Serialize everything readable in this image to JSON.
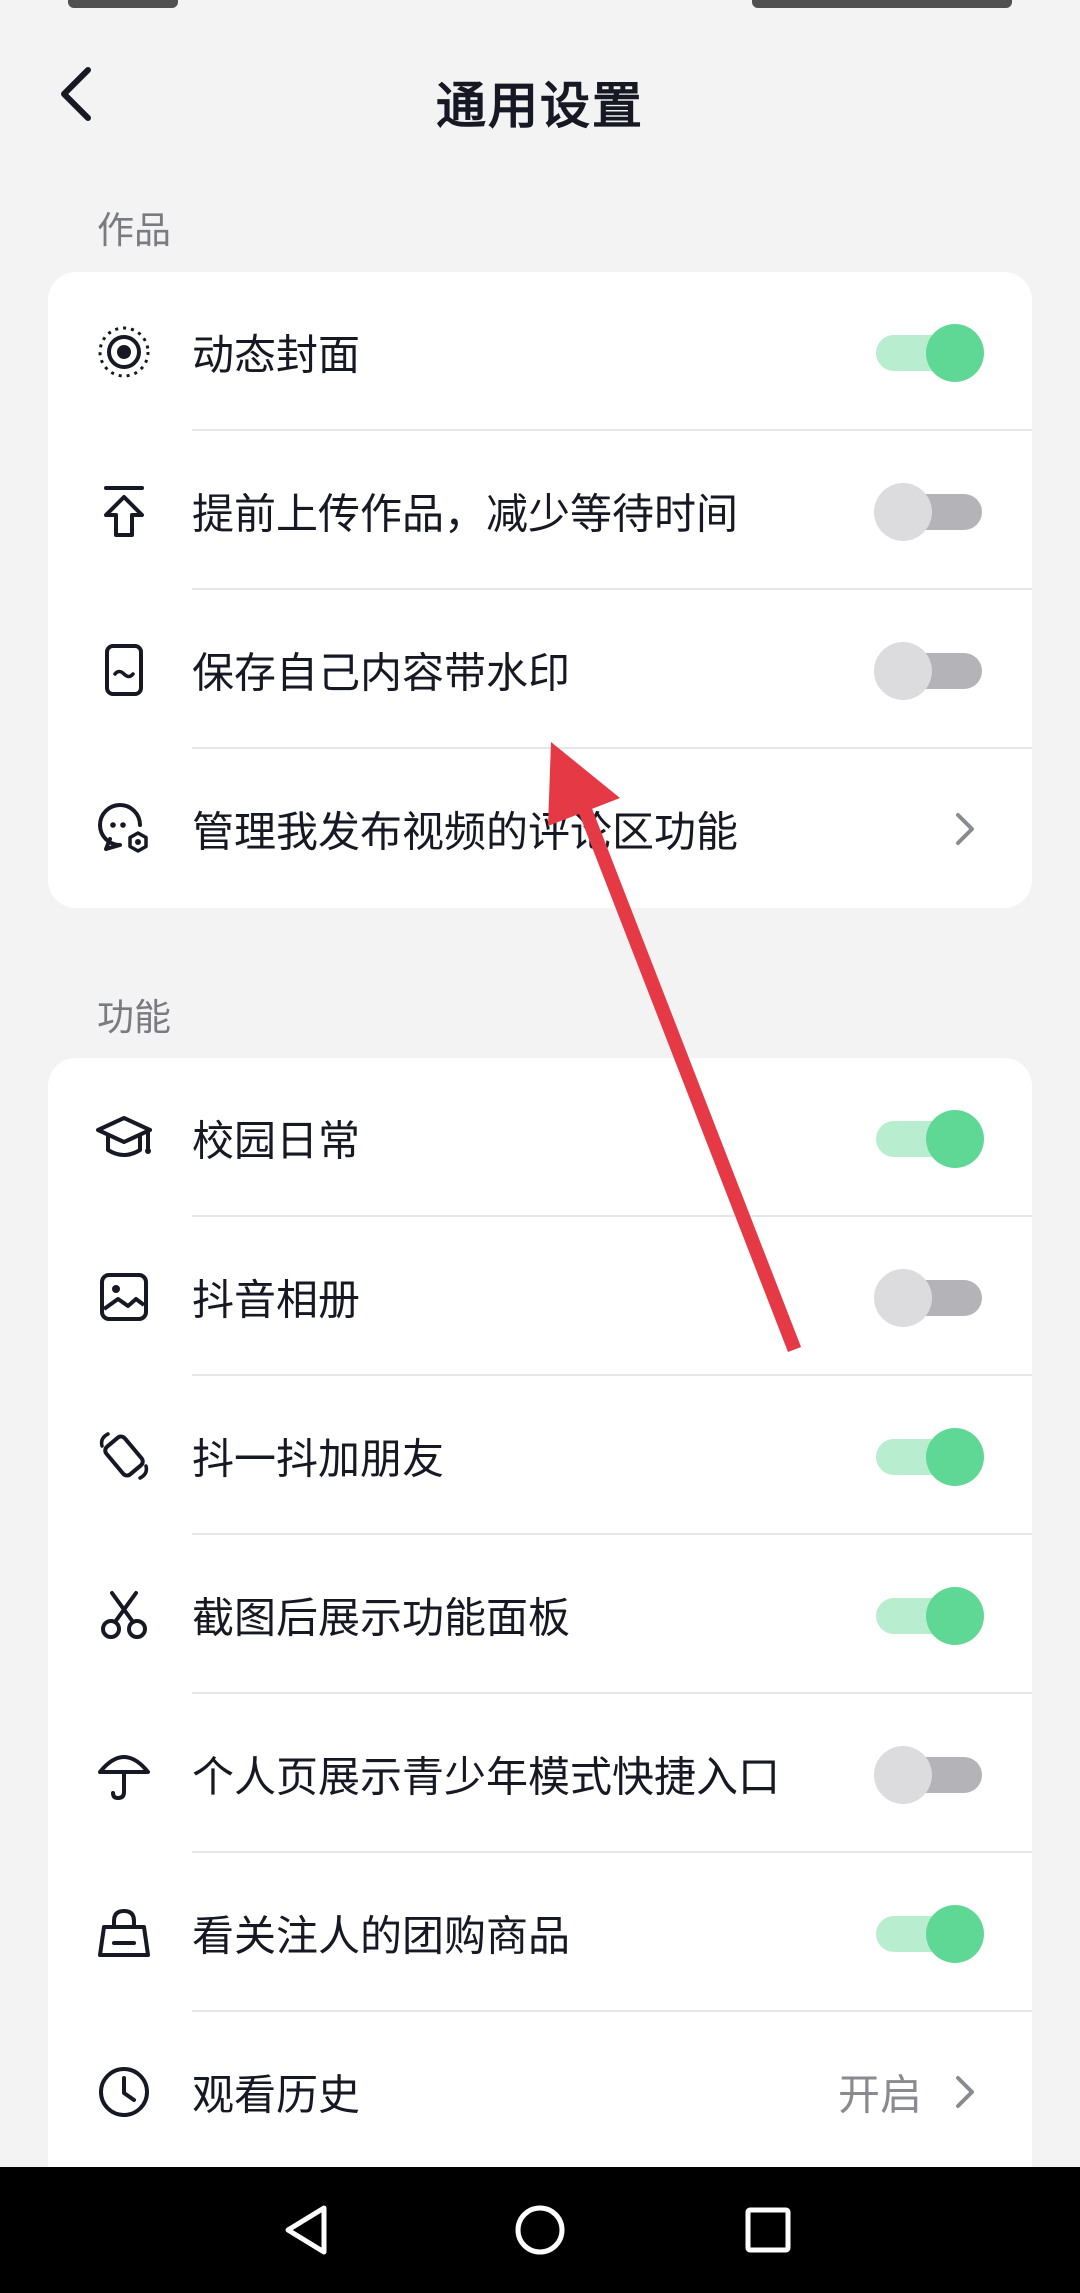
{
  "header": {
    "title": "通用设置",
    "back_icon": "chevron-left-icon"
  },
  "sections": [
    {
      "label": "作品",
      "items": [
        {
          "label": "动态封面",
          "icon": "live-cover-icon",
          "control": "toggle",
          "on": true
        },
        {
          "label": "提前上传作品，减少等待时间",
          "icon": "upload-arrow-icon",
          "control": "toggle",
          "on": false
        },
        {
          "label": "保存自己内容带水印",
          "icon": "watermark-phone-icon",
          "control": "toggle",
          "on": false
        },
        {
          "label": "管理我发布视频的评论区功能",
          "icon": "comment-settings-icon",
          "control": "chevron"
        }
      ]
    },
    {
      "label": "功能",
      "items": [
        {
          "label": "校园日常",
          "icon": "graduation-cap-icon",
          "control": "toggle",
          "on": true
        },
        {
          "label": "抖音相册",
          "icon": "photo-album-icon",
          "control": "toggle",
          "on": false
        },
        {
          "label": "抖一抖加朋友",
          "icon": "shake-phone-icon",
          "control": "toggle",
          "on": true
        },
        {
          "label": "截图后展示功能面板",
          "icon": "scissors-icon",
          "control": "toggle",
          "on": true
        },
        {
          "label": "个人页展示青少年模式快捷入口",
          "icon": "umbrella-icon",
          "control": "toggle",
          "on": false
        },
        {
          "label": "看关注人的团购商品",
          "icon": "shopping-bag-icon",
          "control": "toggle",
          "on": true
        },
        {
          "label": "观看历史",
          "icon": "clock-icon",
          "control": "chevron",
          "value": "开启"
        }
      ]
    }
  ],
  "nav": {
    "back_icon": "triangle-back-icon",
    "home_icon": "circle-home-icon",
    "recents_icon": "square-recents-icon"
  },
  "colors": {
    "toggle_on_knob": "#5fd896",
    "toggle_on_track": "#b9edcf",
    "toggle_off_knob": "#dcdcde",
    "toggle_off_track": "#b3b3b8",
    "annotation_arrow": "#e63946",
    "background": "#f3f3f3"
  }
}
